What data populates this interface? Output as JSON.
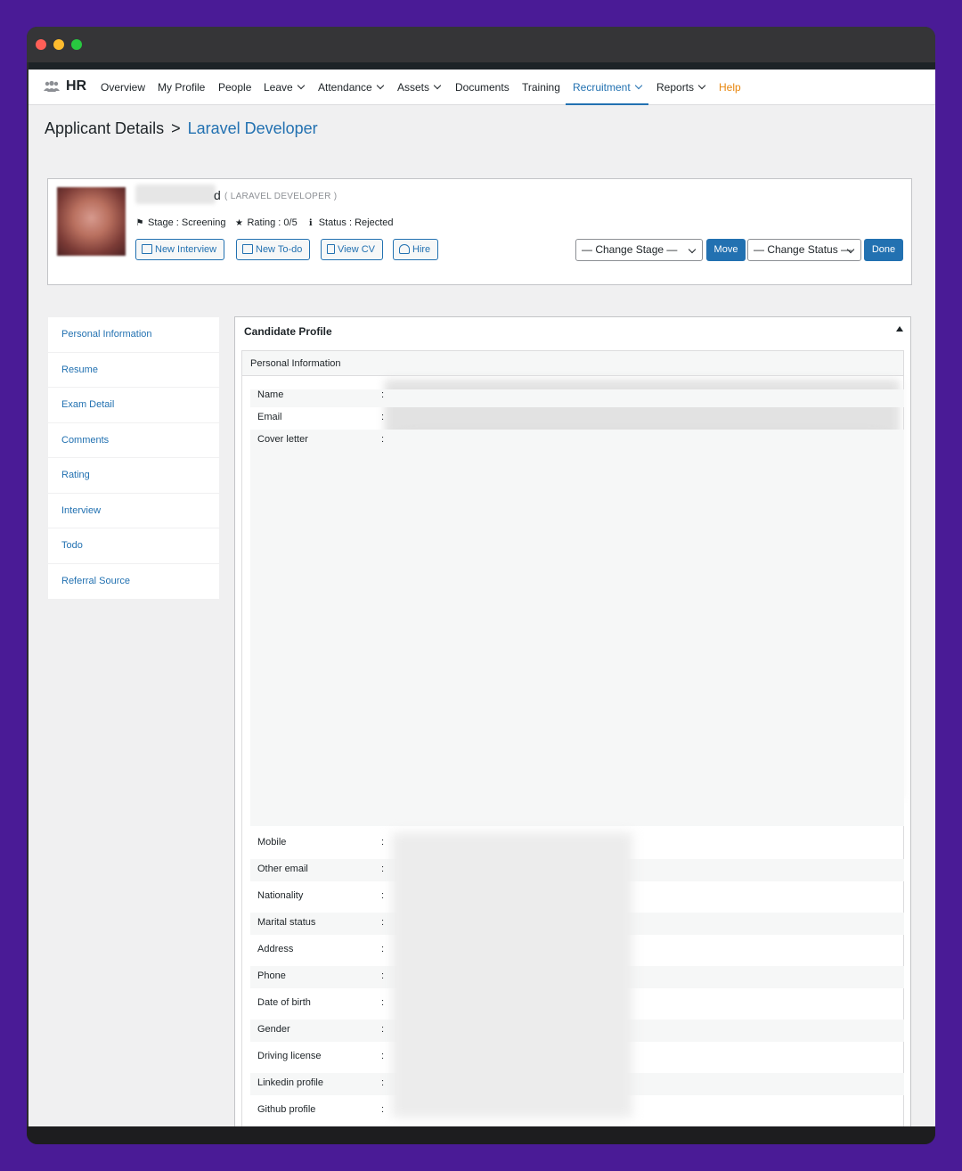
{
  "nav": {
    "brand": "HR",
    "items": [
      {
        "label": "Overview",
        "dropdown": false
      },
      {
        "label": "My Profile",
        "dropdown": false
      },
      {
        "label": "People",
        "dropdown": false
      },
      {
        "label": "Leave",
        "dropdown": true
      },
      {
        "label": "Attendance",
        "dropdown": true
      },
      {
        "label": "Assets",
        "dropdown": true
      },
      {
        "label": "Documents",
        "dropdown": false
      },
      {
        "label": "Training",
        "dropdown": false
      },
      {
        "label": "Recruitment",
        "dropdown": true,
        "active": true
      },
      {
        "label": "Reports",
        "dropdown": true
      },
      {
        "label": "Help",
        "dropdown": false
      }
    ],
    "active_color": "#2271b1",
    "help_color": "#e8860d"
  },
  "page": {
    "title": "Applicant Details",
    "breadcrumb_sep": ">",
    "breadcrumb_current": "Laravel Developer"
  },
  "applicant": {
    "name_visible_tail": "d",
    "position": "( LARAVEL DEVELOPER )",
    "stage": "Stage : Screening",
    "rating": "Rating : 0/5",
    "status": "Status : Rejected",
    "buttons": {
      "new_interview": "New Interview",
      "new_todo": "New To-do",
      "view_cv": "View CV",
      "hire": "Hire"
    },
    "change_stage": "— Change Stage —",
    "move": "Move",
    "change_status": "— Change Status —",
    "done": "Done"
  },
  "sidenav": {
    "items": [
      "Personal Information",
      "Resume",
      "Exam Detail",
      "Comments",
      "Rating",
      "Interview",
      "Todo",
      "Referral Source"
    ]
  },
  "profile": {
    "title": "Candidate Profile",
    "section": "Personal Information",
    "fields": [
      "Name",
      "Email",
      "Cover letter",
      "Mobile",
      "Other email",
      "Nationality",
      "Marital status",
      "Address",
      "Phone",
      "Date of birth",
      "Gender",
      "Driving license",
      "Linkedin profile",
      "Github profile"
    ],
    "separator": ":"
  }
}
